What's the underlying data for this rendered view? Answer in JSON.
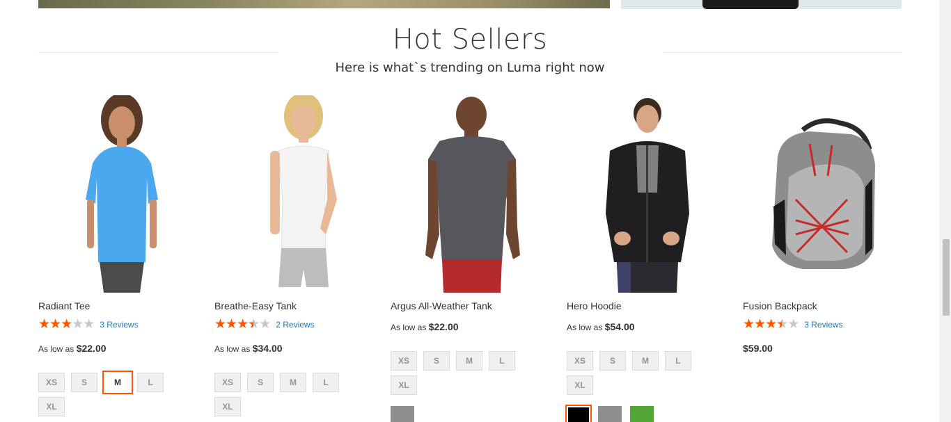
{
  "section": {
    "title": "Hot Sellers",
    "subtitle": "Here is what`s trending on Luma right now"
  },
  "colors": {
    "accent": "#ff5501",
    "link": "#1979c3",
    "star_off": "#c7c7c7"
  },
  "products": [
    {
      "name": "Radiant Tee",
      "rating_stars": 3,
      "reviews": "3 Reviews",
      "price_prefix": "As low as",
      "price": "$22.00",
      "sizes": [
        "XS",
        "S",
        "M",
        "L",
        "XL"
      ],
      "selected_size": "M"
    },
    {
      "name": "Breathe-Easy Tank",
      "rating_stars": 3.5,
      "reviews": "2 Reviews",
      "price_prefix": "As low as",
      "price": "$34.00",
      "sizes": [
        "XS",
        "S",
        "M",
        "L",
        "XL"
      ]
    },
    {
      "name": "Argus All-Weather Tank",
      "price_prefix": "As low as",
      "price": "$22.00",
      "sizes": [
        "XS",
        "S",
        "M",
        "L",
        "XL"
      ],
      "colors": [
        "#8f8f8f"
      ]
    },
    {
      "name": "Hero Hoodie",
      "price_prefix": "As low as",
      "price": "$54.00",
      "sizes": [
        "XS",
        "S",
        "M",
        "L",
        "XL"
      ],
      "colors": [
        "#000000",
        "#8f8f8f",
        "#52a734"
      ],
      "selected_color": "#000000"
    },
    {
      "name": "Fusion Backpack",
      "rating_stars": 3.5,
      "reviews": "3 Reviews",
      "price": "$59.00"
    }
  ]
}
